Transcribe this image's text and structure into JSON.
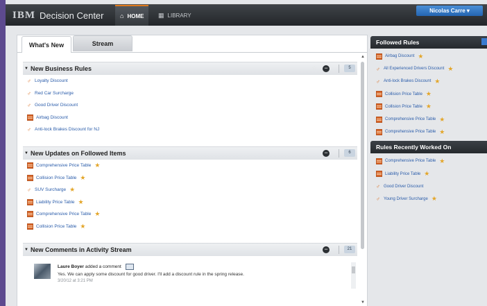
{
  "header": {
    "brand_logo": "IBM",
    "app_title": "Decision Center",
    "nav": [
      {
        "label": "HOME",
        "icon": "home-icon",
        "active": true
      },
      {
        "label": "LIBRARY",
        "icon": "library-grid-icon",
        "active": false
      }
    ],
    "user": "Nicolas Carre ▾"
  },
  "tabs": [
    {
      "label": "What's New",
      "active": true
    },
    {
      "label": "Stream",
      "active": false
    }
  ],
  "sections": [
    {
      "title": "New Business Rules",
      "count": "5",
      "items": [
        {
          "type": "rule",
          "label": "Loyalty Discount",
          "starred": false
        },
        {
          "type": "rule",
          "label": "Red Car Surcharge",
          "starred": false
        },
        {
          "type": "rule",
          "label": "Good Driver Discount",
          "starred": false
        },
        {
          "type": "table",
          "label": "Airbag Discount",
          "starred": false
        },
        {
          "type": "rule",
          "label": "Anti-lock Brakes Discount for NJ",
          "starred": false
        }
      ]
    },
    {
      "title": "New Updates on Followed Items",
      "count": "6",
      "items": [
        {
          "type": "table",
          "label": "Comprehensive Price Table",
          "starred": true
        },
        {
          "type": "table",
          "label": "Collision Price Table",
          "starred": true
        },
        {
          "type": "rule",
          "label": "SUV Surcharge",
          "starred": true
        },
        {
          "type": "table",
          "label": "Liability Price Table",
          "starred": true
        },
        {
          "type": "table",
          "label": "Comprehensive Price Table",
          "starred": true
        },
        {
          "type": "table",
          "label": "Collision Price Table",
          "starred": true
        }
      ]
    },
    {
      "title": "New Comments in Activity Stream",
      "count": "21",
      "comment": {
        "author": "Laure Boyer",
        "action": "added a comment",
        "text": "Yes. We can apply some discount for good driver. I'll add a discount rule in the spring release.",
        "time": "3/20/12 at 3:21 PM"
      }
    }
  ],
  "followed_rules": {
    "title": "Followed Rules",
    "items": [
      {
        "type": "table",
        "label": "Airbag Discount",
        "starred": true
      },
      {
        "type": "rule",
        "label": "All Experienced Drivers Discount",
        "starred": true
      },
      {
        "type": "rule",
        "label": "Anti-lock Brakes Discount",
        "starred": true
      },
      {
        "type": "table",
        "label": "Collision Price Table",
        "starred": true
      },
      {
        "type": "table",
        "label": "Collision Price Table",
        "starred": true
      },
      {
        "type": "table",
        "label": "Comprehensive Price Table",
        "starred": true
      },
      {
        "type": "table",
        "label": "Comprehensive Price Table",
        "starred": true
      }
    ]
  },
  "recent_rules": {
    "title": "Rules Recently Worked On",
    "items": [
      {
        "type": "table",
        "label": "Comprehensive Price Table",
        "starred": true
      },
      {
        "type": "table",
        "label": "Liability Price Table",
        "starred": true
      },
      {
        "type": "rule",
        "label": "Good Driver Discount",
        "starred": false
      },
      {
        "type": "rule",
        "label": "Young Driver Surcharge",
        "starred": true
      }
    ]
  },
  "colors": {
    "link": "#2a5caa",
    "accent": "#e07a1c",
    "star": "#e3a62a",
    "user_button": "#2465b2"
  }
}
